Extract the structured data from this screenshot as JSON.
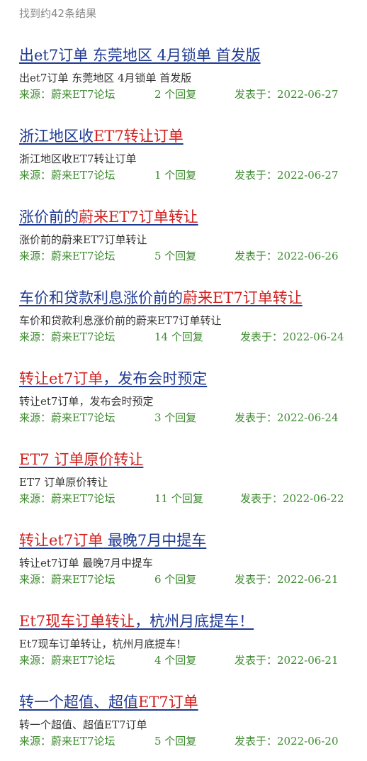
{
  "result_count": "找到约42条结果",
  "meta_labels": {
    "source_prefix": "来源：蔚来ET7论坛",
    "reply_suffix": "个回复",
    "date_prefix": "发表于："
  },
  "results": [
    {
      "title_parts": [
        {
          "t": "出et7订单 东莞地区 4月锁单 首发版",
          "hl": false
        }
      ],
      "snippet": "出et7订单 东莞地区 4月锁单 首发版",
      "source": "来源：蔚来ET7论坛",
      "replies": "2 个回复",
      "date": "发表于：2022-06-27"
    },
    {
      "title_parts": [
        {
          "t": "浙江地区收",
          "hl": false
        },
        {
          "t": "ET7转让订单",
          "hl": true
        }
      ],
      "snippet": "浙江地区收ET7转让订单",
      "source": "来源：蔚来ET7论坛",
      "replies": "1 个回复",
      "date": "发表于：2022-06-27"
    },
    {
      "title_parts": [
        {
          "t": "涨价前的",
          "hl": false
        },
        {
          "t": "蔚来ET7订单转让",
          "hl": true
        }
      ],
      "snippet": "涨价前的蔚来ET7订单转让",
      "source": "来源：蔚来ET7论坛",
      "replies": "5 个回复",
      "date": "发表于：2022-06-26"
    },
    {
      "title_parts": [
        {
          "t": "车价和贷款利息涨价前的",
          "hl": false
        },
        {
          "t": "蔚来ET7订单转让",
          "hl": true
        }
      ],
      "snippet": "车价和贷款利息涨价前的蔚来ET7订单转让",
      "source": "来源：蔚来ET7论坛",
      "replies": "14 个回复",
      "date": "发表于：2022-06-24"
    },
    {
      "title_parts": [
        {
          "t": "转让et7订单",
          "hl": true
        },
        {
          "t": "，发布会时预定",
          "hl": false
        }
      ],
      "snippet": "转让et7订单，发布会时预定",
      "source": "来源：蔚来ET7论坛",
      "replies": "3 个回复",
      "date": "发表于：2022-06-24"
    },
    {
      "title_parts": [
        {
          "t": "ET7 订单原价转让",
          "hl": true
        }
      ],
      "snippet": "ET7 订单原价转让",
      "source": "来源：蔚来ET7论坛",
      "replies": "11 个回复",
      "date": "发表于：2022-06-22"
    },
    {
      "title_parts": [
        {
          "t": "转让et7订单",
          "hl": true
        },
        {
          "t": " 最晚7月中提车",
          "hl": false
        }
      ],
      "snippet": "转让et7订单 最晚7月中提车",
      "source": "来源：蔚来ET7论坛",
      "replies": "6 个回复",
      "date": "发表于：2022-06-21"
    },
    {
      "title_parts": [
        {
          "t": "Et7现车订单转让",
          "hl": true
        },
        {
          "t": "，杭州月底提车！",
          "hl": false
        }
      ],
      "snippet": "Et7现车订单转让，杭州月底提车！",
      "source": "来源：蔚来ET7论坛",
      "replies": "4 个回复",
      "date": "发表于：2022-06-21"
    },
    {
      "title_parts": [
        {
          "t": "转一个超值、超值",
          "hl": false
        },
        {
          "t": "ET7订单",
          "hl": true
        }
      ],
      "snippet": "转一个超值、超值ET7订单",
      "source": "来源：蔚来ET7论坛",
      "replies": "5 个回复",
      "date": "发表于：2022-06-20"
    }
  ],
  "colors": {
    "title": "#1f3a93",
    "highlight": "#d0201f",
    "meta": "#3c8a2e",
    "snippet": "#333333",
    "count": "#8a8a8a"
  }
}
